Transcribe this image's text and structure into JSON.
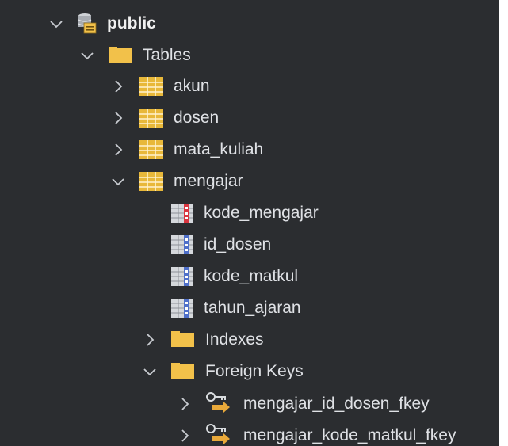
{
  "tree": {
    "schema": {
      "label": "public",
      "icon": "schema-icon",
      "expanded": true
    },
    "tables_folder": {
      "label": "Tables",
      "icon": "folder-icon",
      "expanded": true
    },
    "tables": [
      {
        "label": "akun",
        "icon": "table-icon",
        "expanded": false
      },
      {
        "label": "dosen",
        "icon": "table-icon",
        "expanded": false
      },
      {
        "label": "mata_kuliah",
        "icon": "table-icon",
        "expanded": false
      },
      {
        "label": "mengajar",
        "icon": "table-icon",
        "expanded": true
      }
    ],
    "columns": [
      {
        "label": "kode_mengajar",
        "icon": "primary-key-column-icon"
      },
      {
        "label": "id_dosen",
        "icon": "column-icon"
      },
      {
        "label": "kode_matkul",
        "icon": "column-icon"
      },
      {
        "label": "tahun_ajaran",
        "icon": "column-icon"
      }
    ],
    "indexes_folder": {
      "label": "Indexes",
      "icon": "folder-icon",
      "expanded": false
    },
    "foreign_keys_folder": {
      "label": "Foreign Keys",
      "icon": "folder-icon",
      "expanded": true
    },
    "foreign_keys": [
      {
        "label": "mengajar_id_dosen_fkey",
        "icon": "foreign-key-icon",
        "expanded": false
      },
      {
        "label": "mengajar_kode_matkul_fkey",
        "icon": "foreign-key-icon",
        "expanded": false
      }
    ]
  },
  "colors": {
    "background": "#2b2d30",
    "text": "#dfe1e5",
    "folder": "#f2c14a",
    "table_grid": "#e8b83a",
    "primary_key_marker": "#d9353f",
    "column_marker": "#4e6fc9",
    "key_gold": "#e9a93a"
  }
}
